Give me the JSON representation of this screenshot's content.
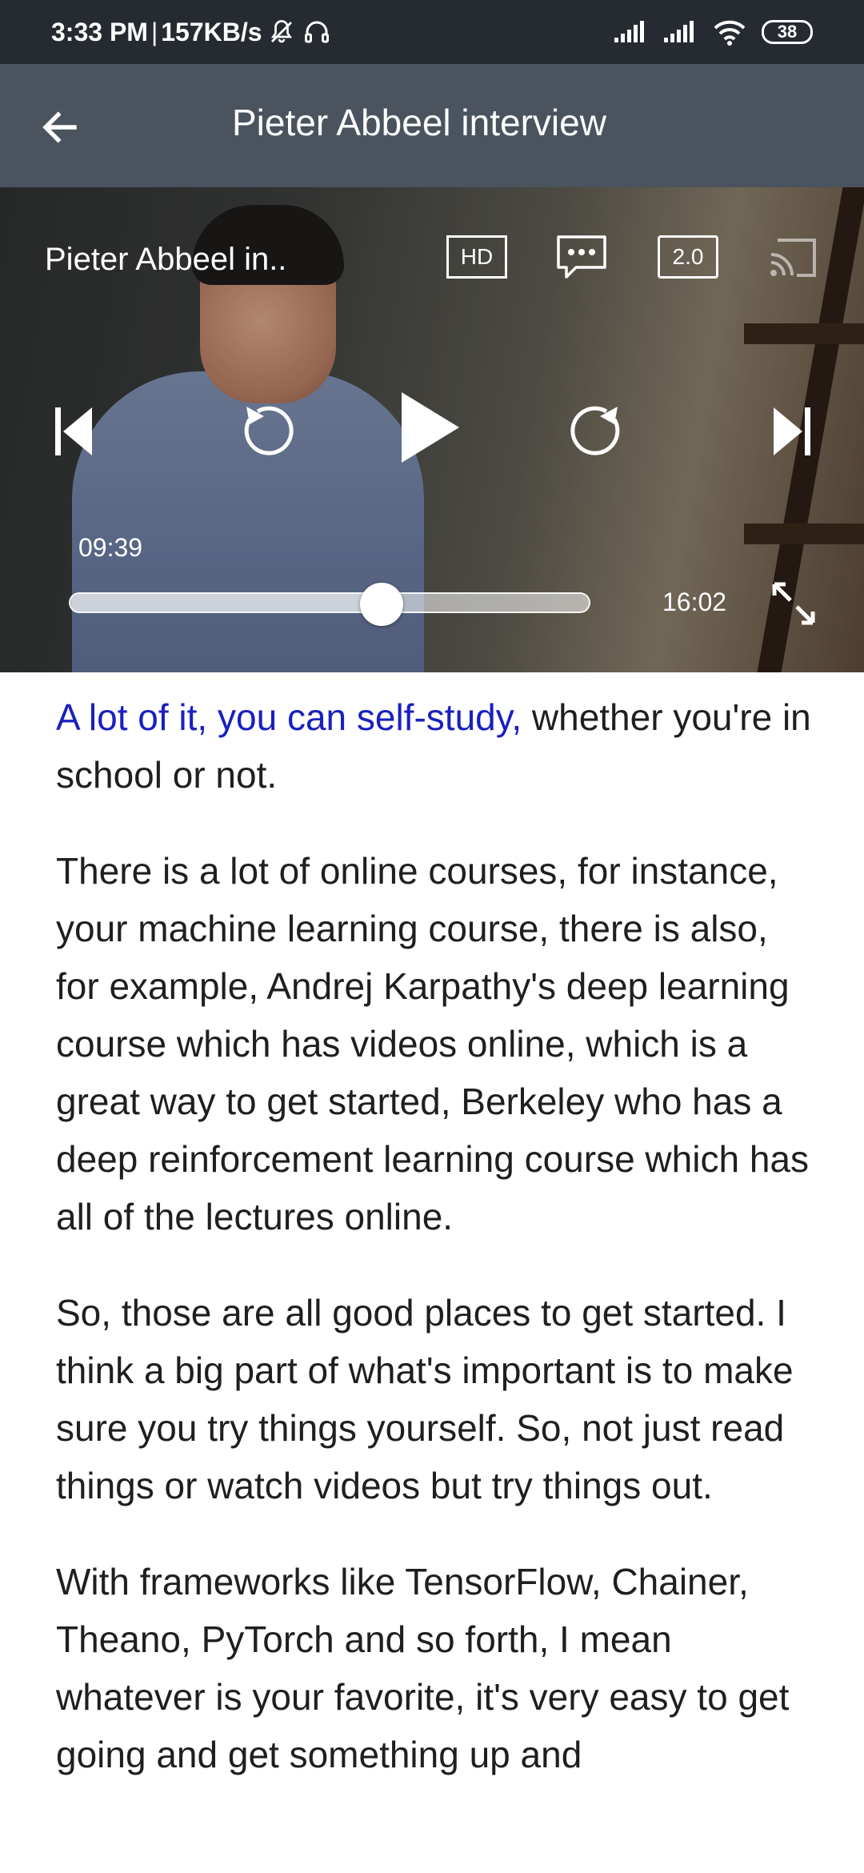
{
  "status_bar": {
    "time": "3:33 PM",
    "separator": "|",
    "network_speed": "157KB/s",
    "battery_level": "38",
    "icons": [
      "mute-bell-icon",
      "headset-icon",
      "signal-icon",
      "signal-icon",
      "wifi-icon",
      "battery-icon"
    ]
  },
  "app_bar": {
    "title": "Pieter Abbeel interview",
    "back_icon": "arrow-left-icon"
  },
  "player": {
    "title": "Pieter Abbeel in..",
    "hd_label": "HD",
    "speed_label": "2.0",
    "current_time": "09:39",
    "total_time": "16:02",
    "progress_fraction": 0.6
  },
  "transcript": {
    "paragraph_1_highlight": "A lot of it, you can self-study,",
    "paragraph_1_rest": " whether you're in school or not.",
    "paragraph_2": "There is a lot of online courses, for instance, your machine learning course, there is also, for example, Andrej Karpathy's deep learning course which has videos online, which is a great way to get started, Berkeley who has a deep reinforcement learning course which has all of the lectures online.",
    "paragraph_3": "So, those are all good places to get started. I think a big part of what's important is to make sure you try things yourself. So, not just read things or watch videos but try things out.",
    "paragraph_4": "With frameworks like TensorFlow, Chainer, Theano, PyTorch and so forth, I mean whatever is your favorite, it's very easy to get going and get something up and"
  },
  "colors": {
    "status_bar_bg": "#262b31",
    "app_bar_bg": "#4a535e",
    "highlight_text": "#1a1fc0"
  }
}
